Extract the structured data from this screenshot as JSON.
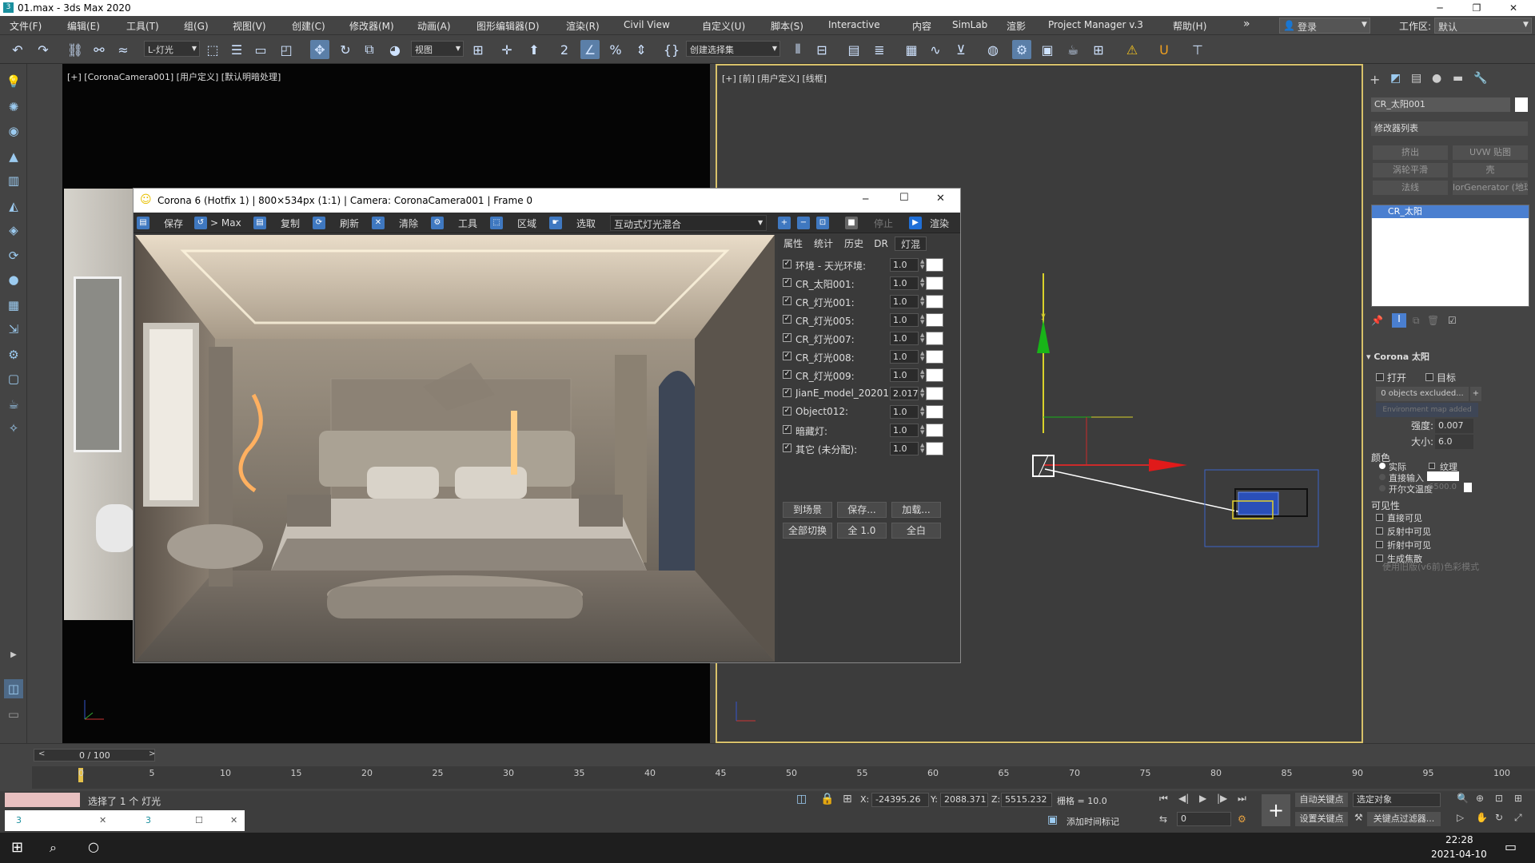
{
  "app": {
    "title": "01.max - 3ds Max 2020"
  },
  "menubar": {
    "items": [
      "文件(F)",
      "编辑(E)",
      "工具(T)",
      "组(G)",
      "视图(V)",
      "创建(C)",
      "修改器(M)",
      "动画(A)",
      "图形编辑器(D)",
      "渲染(R)",
      "Civil View",
      "自定义(U)",
      "脚本(S)",
      "Interactive",
      "内容",
      "SimLab",
      "渲影",
      "Project Manager v.3",
      "帮助(H)"
    ],
    "more": "»",
    "login": "登录",
    "workspace_label": "工作区:",
    "workspace_value": "默认"
  },
  "toolbar": {
    "light_filter": "L-灯光",
    "view_dropdown": "视图",
    "selection_set": "创建选择集"
  },
  "viewports": {
    "left_label": "[+] [CoronaCamera001] [用户定义] [默认明暗处理]",
    "right_label": "[+] [前] [用户定义] [线框]",
    "axis_y": "y"
  },
  "corona": {
    "title": "Corona 6 (Hotfix 1) | 800×534px (1:1) | Camera: CoronaCamera001 | Frame 0",
    "toolbar": {
      "save": "保存",
      "to_max": "> Max",
      "copy": "复制",
      "refresh": "刷新",
      "clear": "清除",
      "tools": "工具",
      "region": "区域",
      "select": "选取",
      "mode": "互动式灯光混合",
      "stop": "停止",
      "render": "渲染"
    },
    "tabs": [
      "属性",
      "统计",
      "历史",
      "DR",
      "灯混"
    ],
    "lights": [
      {
        "name": "环境 - 天光环境:",
        "value": "1.0"
      },
      {
        "name": "CR_太阳001:",
        "value": "1.0"
      },
      {
        "name": "CR_灯光001:",
        "value": "1.0"
      },
      {
        "name": "CR_灯光005:",
        "value": "1.0"
      },
      {
        "name": "CR_灯光007:",
        "value": "1.0"
      },
      {
        "name": "CR_灯光008:",
        "value": "1.0"
      },
      {
        "name": "CR_灯光009:",
        "value": "1.0"
      },
      {
        "name": "JianE_model_20201",
        "value": "2.017"
      },
      {
        "name": "Object012:",
        "value": "1.0"
      },
      {
        "name": "暗藏灯:",
        "value": "1.0"
      },
      {
        "name": "其它 (未分配):",
        "value": "1.0"
      }
    ],
    "buttons": {
      "to_scene": "到场景",
      "save": "保存...",
      "load": "加载...",
      "toggle_all": "全部切换",
      "all_one": "全 1.0",
      "all_white": "全白"
    }
  },
  "command_panel": {
    "object_name": "CR_太阳001",
    "modifier_list": "修改器列表",
    "mod_buttons": [
      "挤出",
      "UVW 贴图",
      "涡轮平滑",
      "壳",
      "法线",
      "lorGenerator (地球"
    ],
    "stack_item": "CR_太阳",
    "rollout_title": "Corona 太阳",
    "on_label": "打开",
    "target_label": "目标",
    "excluded": "0 objects excluded...",
    "env_map": "Environment map added",
    "intensity_label": "强度:",
    "intensity_value": "0.007",
    "size_label": "大小:",
    "size_value": "6.0",
    "color_label": "颜色",
    "color_real": "实际",
    "color_texture": "纹理",
    "color_direct": "直接输入",
    "color_kelvin": "开尔文温度",
    "kelvin_value": "6500.0",
    "visibility_label": "可见性",
    "vis_items": [
      "直接可见",
      "反射中可见",
      "折射中可见",
      "生成焦散"
    ],
    "legacy": "使用旧版(v6前)色彩模式"
  },
  "timeline": {
    "frame": "0 / 100",
    "ticks": [
      "0",
      "5",
      "10",
      "15",
      "20",
      "25",
      "30",
      "35",
      "40",
      "45",
      "50",
      "55",
      "60",
      "65",
      "70",
      "75",
      "80",
      "85",
      "90",
      "95",
      "100"
    ]
  },
  "status": {
    "selected": "选择了 1 个 灯光",
    "x_label": "X:",
    "x_value": "-24395.26",
    "y_label": "Y:",
    "y_value": "2088.371",
    "z_label": "Z:",
    "z_value": "5515.232",
    "grid": "栅格 = 10.0",
    "add_time_tag": "添加时间标记",
    "auto_key": "自动关键点",
    "set_key": "设置关键点",
    "selected_obj": "选定对象",
    "key_filters": "关键点过滤器...",
    "frame_field": "0"
  },
  "taskbar": {
    "time": "22:28",
    "date": "2021-04-10"
  },
  "colors": {
    "accent": "#5b7fa8",
    "viewport_border": "#d8c16a",
    "selection": "#4a7fd0"
  }
}
